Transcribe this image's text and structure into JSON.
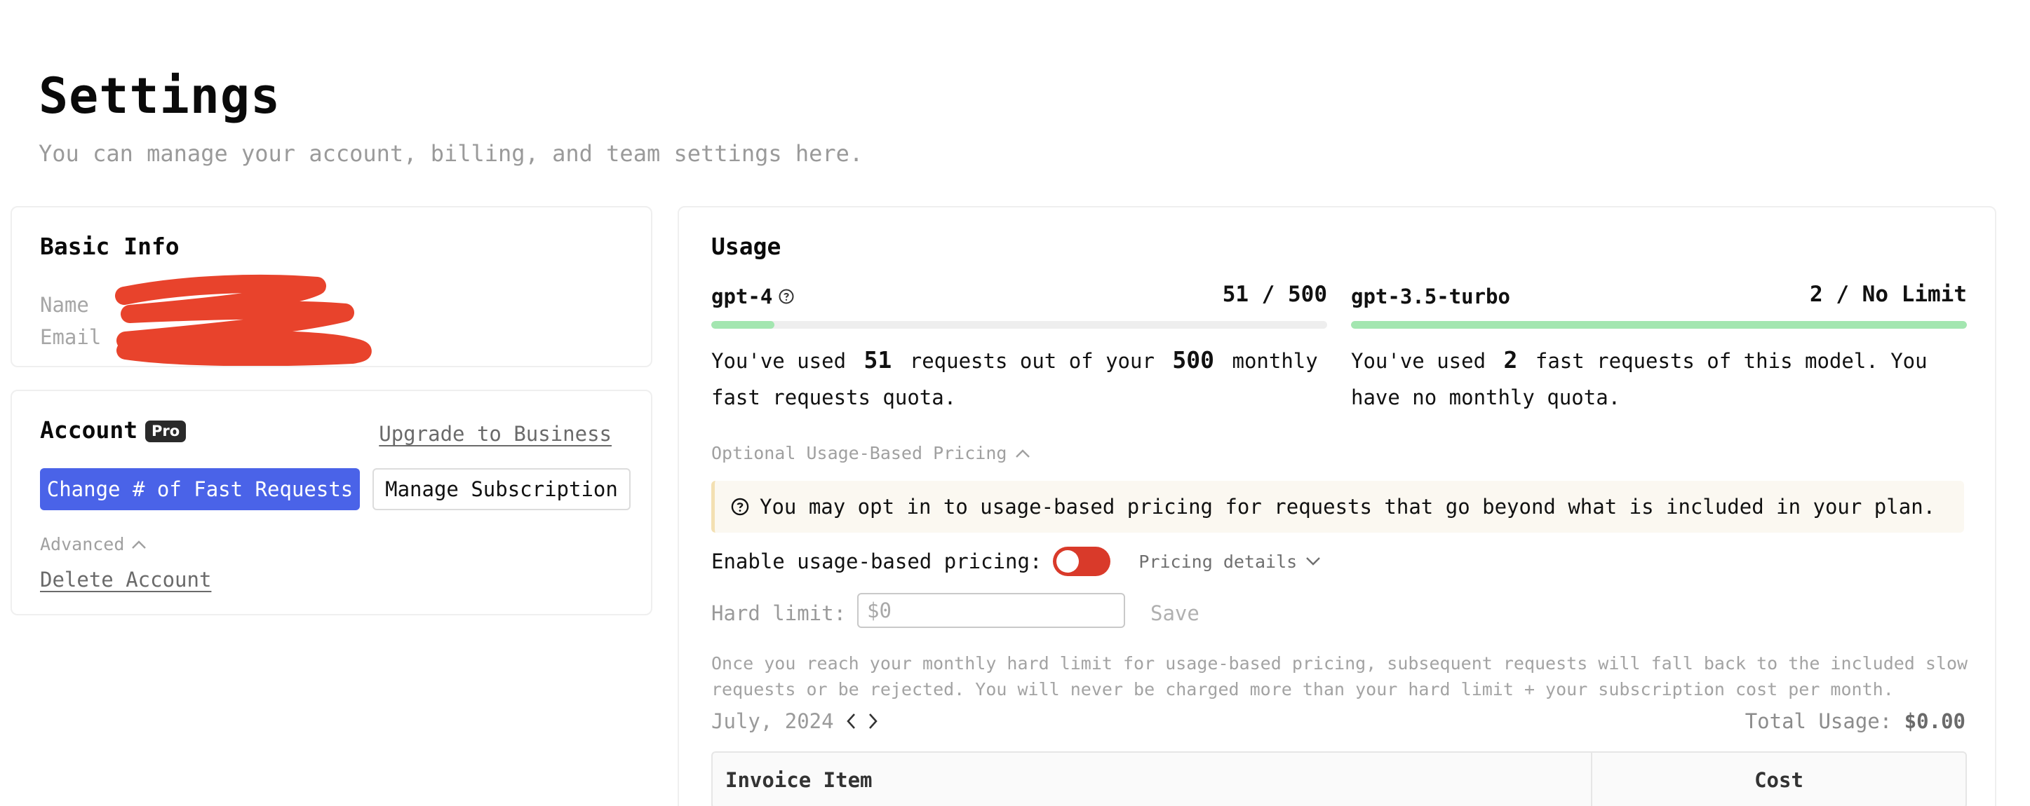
{
  "header": {
    "title": "Settings",
    "subtitle": "You can manage your account, billing, and team settings here."
  },
  "basic_info": {
    "title": "Basic Info",
    "name_label": "Name",
    "email_label": "Email",
    "redaction_color": "#e8432c"
  },
  "account": {
    "title": "Account",
    "badge": "Pro",
    "upgrade_link": "Upgrade to Business",
    "change_requests_button": "Change # of Fast Requests",
    "manage_subscription_button": "Manage Subscription",
    "advanced_label": "Advanced",
    "delete_link": "Delete Account"
  },
  "usage": {
    "title": "Usage",
    "models": [
      {
        "name": "gpt-4",
        "count": "51 / 500",
        "progress_fraction": 0.102,
        "desc_prefix": "You've used",
        "used": "51",
        "desc_mid": "requests out of your",
        "quota": "500",
        "desc_suffix": "monthly fast requests quota."
      },
      {
        "name": "gpt-3.5-turbo",
        "count": "2 / No Limit",
        "progress_fraction": 1.0,
        "desc_prefix": "You've used",
        "used": "2",
        "desc_suffix": "fast requests of this model. You have no monthly quota."
      }
    ],
    "optional_label": "Optional Usage-Based Pricing",
    "notice": "You may opt in to usage-based pricing for requests that go beyond what is included in your plan.",
    "enable_label": "Enable usage-based pricing:",
    "pricing_details": "Pricing details",
    "hard_limit_label": "Hard limit:",
    "hard_limit_placeholder": "$0",
    "save_label": "Save",
    "hard_limit_note": "Once you reach your monthly hard limit for usage-based pricing, subsequent requests will fall back to the included slow requests or be rejected. You will never be charged more than your hard limit + your subscription cost per month.",
    "month": "July, 2024",
    "total_label": "Total Usage:",
    "total_value": "$0.00",
    "table_headers": [
      "Invoice Item",
      "Cost"
    ],
    "colors": {
      "progress_fill": "#a3e6b0",
      "toggle_off": "#d93a2a",
      "primary_button": "#4a63e8"
    }
  }
}
